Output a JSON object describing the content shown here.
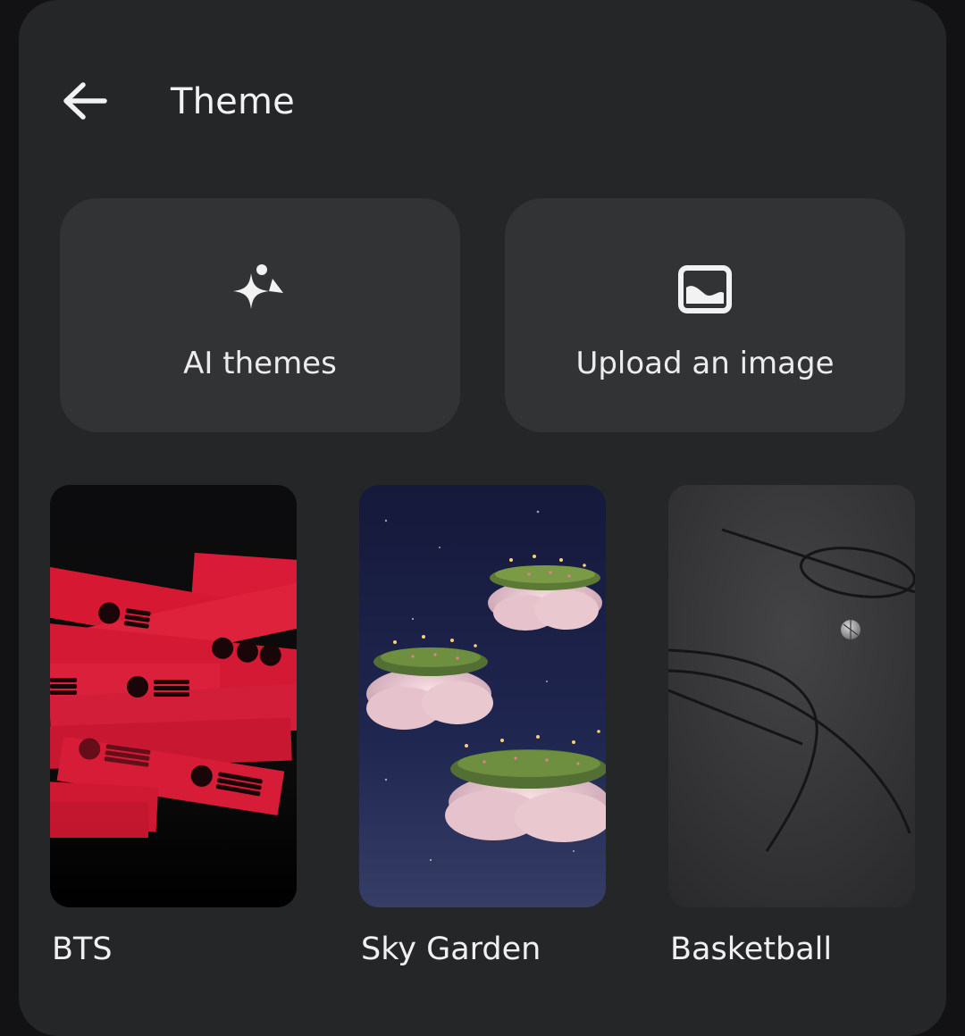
{
  "header": {
    "title": "Theme",
    "back_icon": "arrow-left-icon"
  },
  "actions": [
    {
      "label": "AI themes",
      "icon": "sparkle-icon"
    },
    {
      "label": "Upload an image",
      "icon": "image-icon"
    }
  ],
  "themes": [
    {
      "name": "BTS"
    },
    {
      "name": "Sky Garden"
    },
    {
      "name": "Basketball"
    }
  ],
  "colors": {
    "panel": "#252628",
    "card": "#323335",
    "text": "#f2f2f3",
    "bts_red": "#e8203c"
  }
}
